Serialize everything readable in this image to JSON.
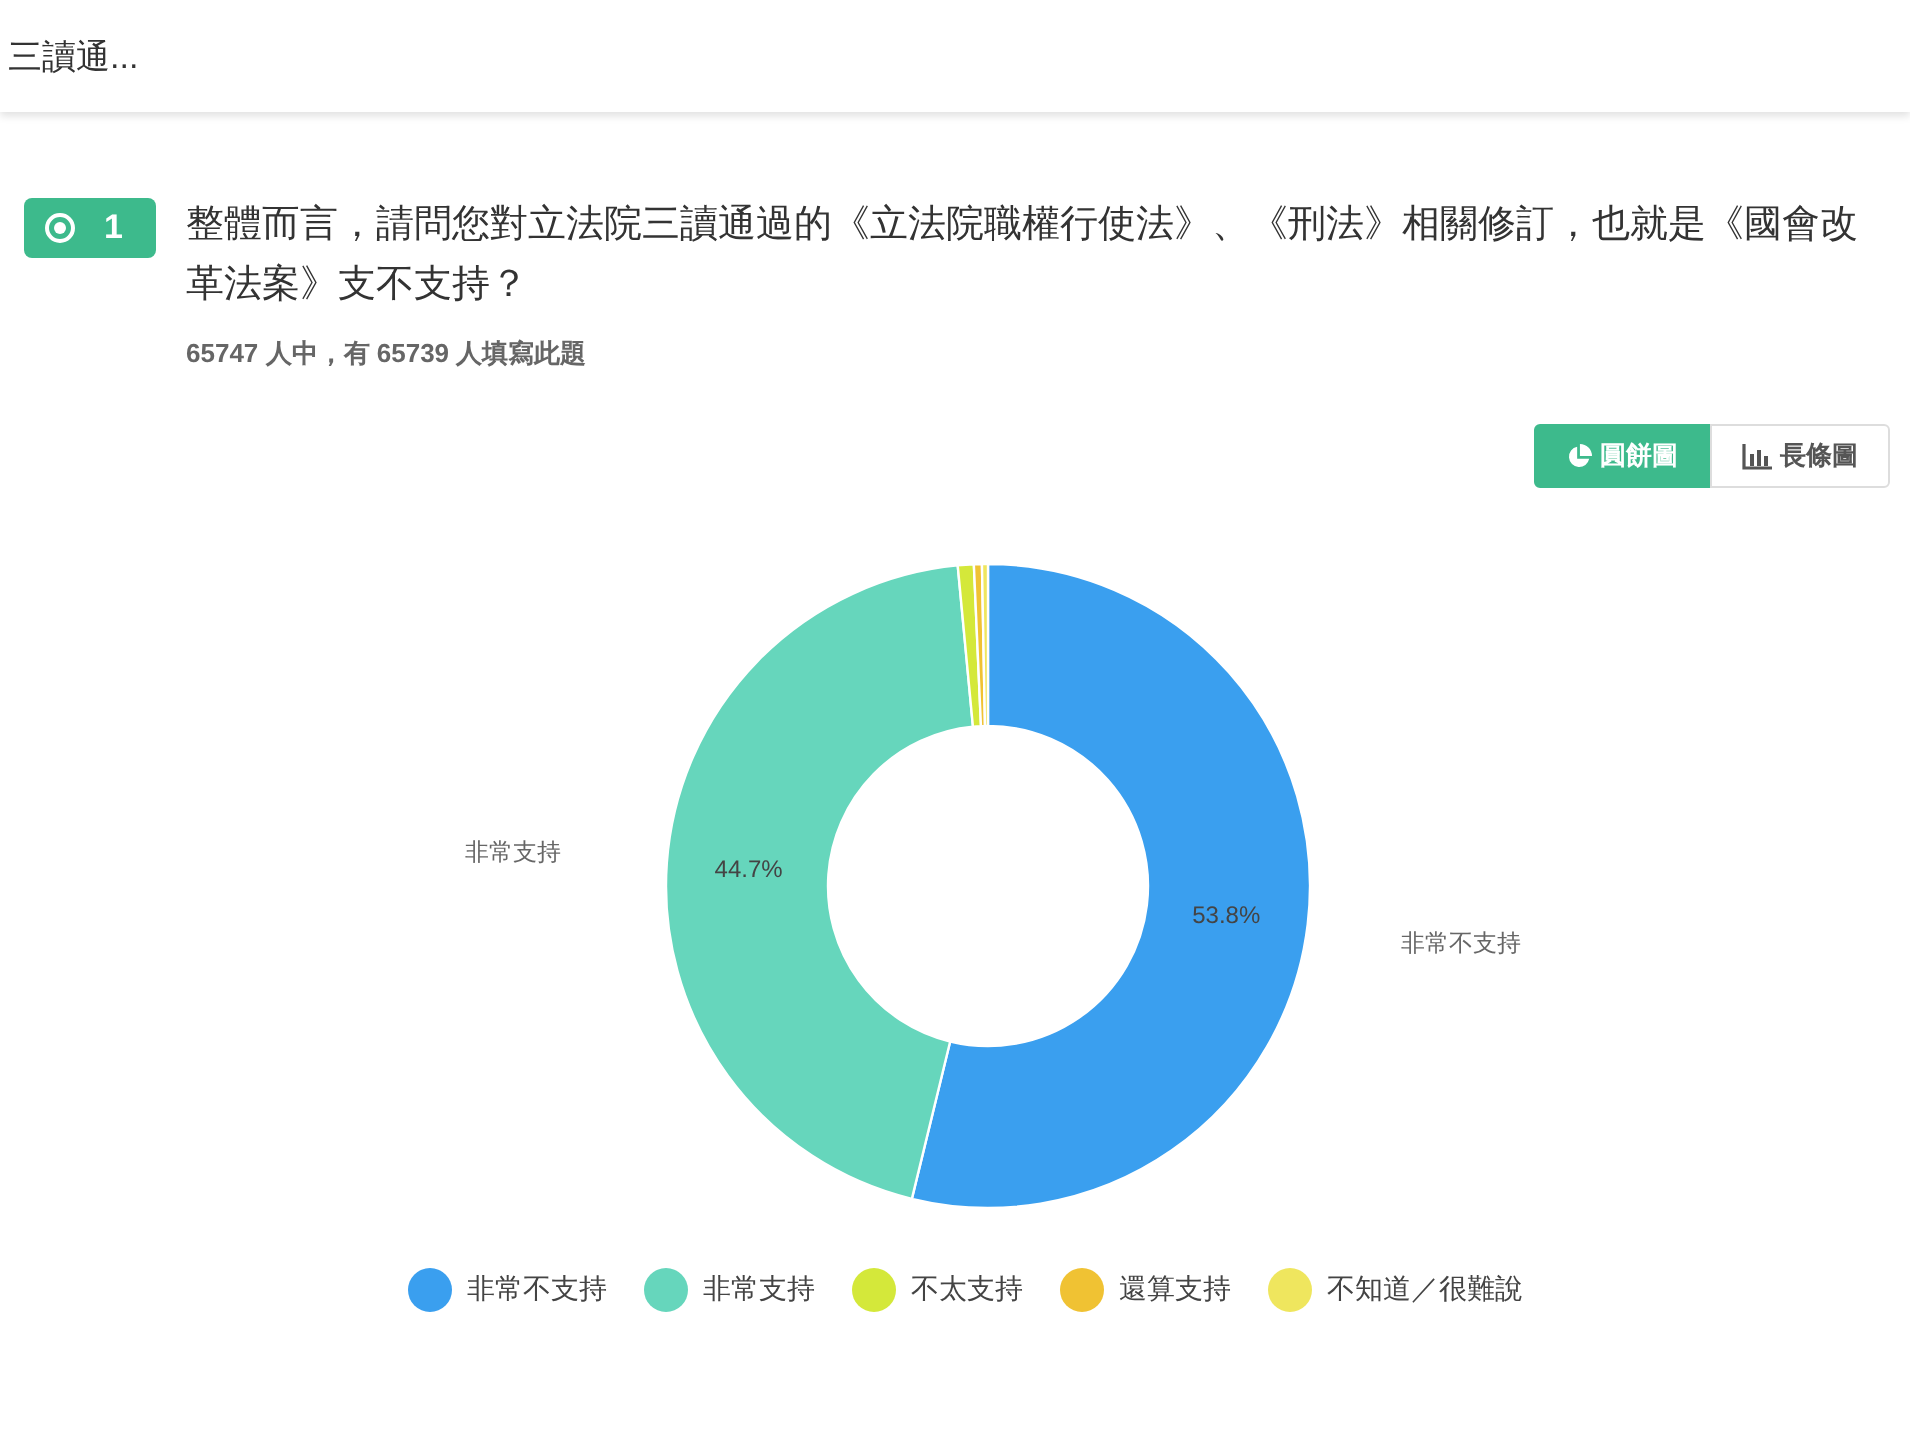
{
  "header": {
    "title": "三讀通..."
  },
  "question": {
    "number": "1",
    "title": "整體而言，請問您對立法院三讀通過的《立法院職權行使法》、《刑法》相關修訂，也就是《國會改革法案》支不支持？",
    "respondents": "65747 人中，有 65739 人填寫此題"
  },
  "view_toggle": [
    {
      "label": "圓餅圖",
      "kind": "pie",
      "selected": true
    },
    {
      "label": "長條圖",
      "kind": "bar",
      "selected": false
    }
  ],
  "chart_data": {
    "type": "donut",
    "categories": [
      "非常不支持",
      "非常支持",
      "不太支持",
      "還算支持",
      "不知道／很難說"
    ],
    "values": [
      53.8,
      44.7,
      0.8,
      0.4,
      0.3
    ],
    "colors": [
      "#3a9fef",
      "#66d6bc",
      "#d4e83a",
      "#f0c233",
      "#efe65e"
    ],
    "value_labels": [
      "53.8%",
      "44.7%",
      null,
      null,
      null
    ]
  }
}
